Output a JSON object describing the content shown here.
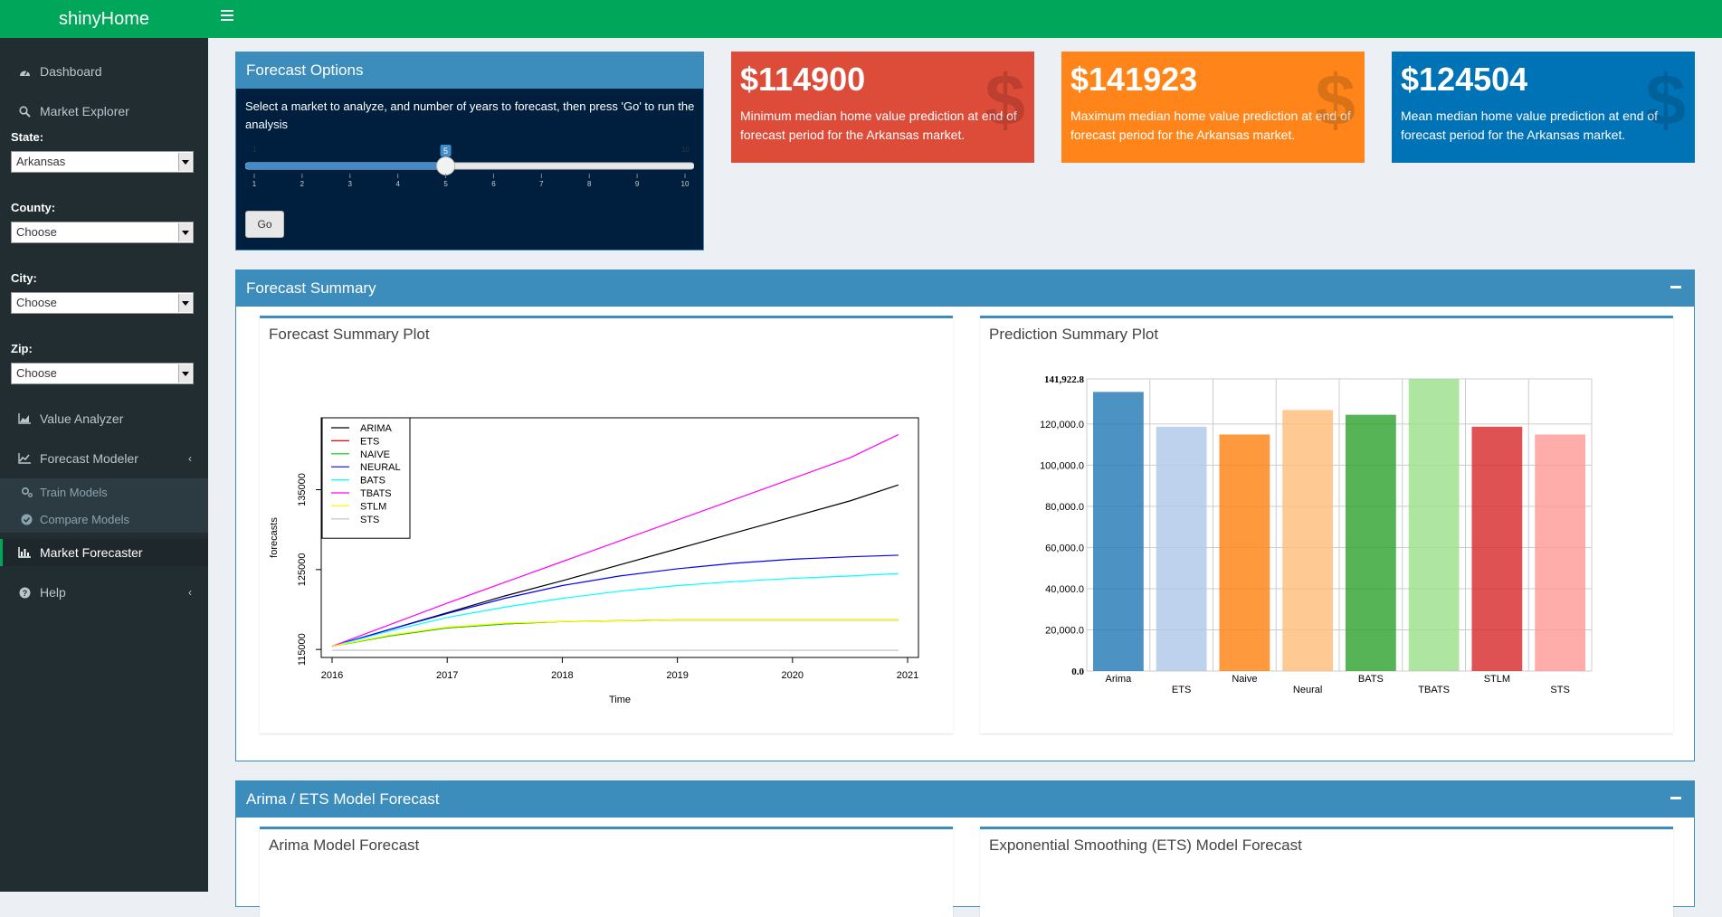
{
  "app": {
    "title": "shinyHome"
  },
  "sidebar": {
    "items": [
      {
        "label": "Dashboard",
        "icon": "dashboard-icon"
      },
      {
        "label": "Market Explorer",
        "icon": "search-icon"
      },
      {
        "label": "Value Analyzer",
        "icon": "area-chart-icon"
      },
      {
        "label": "Forecast Modeler",
        "icon": "line-chart-icon",
        "chevron": "‹"
      },
      {
        "label": "Market Forecaster",
        "icon": "bar-chart-icon",
        "active": true
      },
      {
        "label": "Help",
        "icon": "question-icon",
        "chevron": "‹"
      }
    ],
    "subitems": [
      {
        "label": "Train Models",
        "icon": "cogs-icon"
      },
      {
        "label": "Compare Models",
        "icon": "check-circle-icon"
      }
    ],
    "state": {
      "label": "State:",
      "value": "Arkansas"
    },
    "county": {
      "label": "County:",
      "value": "Choose"
    },
    "city": {
      "label": "City:",
      "value": "Choose"
    },
    "zip": {
      "label": "Zip:",
      "value": "Choose"
    }
  },
  "forecast_options": {
    "title": "Forecast Options",
    "description": "Select a market to analyze, and number of years to forecast, then press 'Go' to run the analysis",
    "slider": {
      "min": 1,
      "max": 10,
      "value": 5,
      "ticks": [
        "1",
        "2",
        "3",
        "4",
        "5",
        "6",
        "7",
        "8",
        "9",
        "10"
      ]
    },
    "go_label": "Go"
  },
  "value_boxes": [
    {
      "value": "$114900",
      "description": "Minimum median home value prediction at end of forecast period for the Arkansas market.",
      "color": "#dd4b39"
    },
    {
      "value": "$141923",
      "description": "Maximum median home value prediction at end of forecast period for the Arkansas market.",
      "color": "#ff851b"
    },
    {
      "value": "$124504",
      "description": "Mean median home value prediction at end of forecast period for the Arkansas market.",
      "color": "#0073b7"
    }
  ],
  "forecast_summary": {
    "title": "Forecast Summary",
    "line_plot_title": "Forecast Summary Plot",
    "bar_plot_title": "Prediction Summary Plot"
  },
  "arima_ets": {
    "title": "Arima / ETS Model Forecast",
    "arima_title": "Arima Model Forecast",
    "ets_title": "Exponential Smoothing (ETS) Model Forecast"
  },
  "chart_data": [
    {
      "type": "line",
      "xlabel": "Time",
      "ylabel": "forecasts",
      "xlim": [
        2016,
        2021
      ],
      "ylim": [
        114000,
        144000
      ],
      "xticks": [
        "2016",
        "2017",
        "2018",
        "2019",
        "2020",
        "2021"
      ],
      "yticks": [
        "115000",
        "125000",
        "135000"
      ],
      "x": [
        2016,
        2016.5,
        2017,
        2017.5,
        2018,
        2018.5,
        2019,
        2019.5,
        2020,
        2020.5,
        2020.92
      ],
      "series": [
        {
          "name": "ARIMA",
          "color": "#000000",
          "values": [
            115400,
            117500,
            119600,
            121700,
            123600,
            125600,
            127600,
            129600,
            131600,
            133600,
            135600
          ]
        },
        {
          "name": "ETS",
          "color": "#ff0000",
          "values": [
            115400,
            116700,
            117700,
            118200,
            118500,
            118600,
            118700,
            118700,
            118700,
            118700,
            118700
          ]
        },
        {
          "name": "NAIVE",
          "color": "#00cd00",
          "values": [
            115400,
            116700,
            117700,
            118200,
            118500,
            118600,
            118700,
            118700,
            118700,
            118700,
            118700
          ]
        },
        {
          "name": "NEURAL",
          "color": "#0000ff",
          "values": [
            115400,
            117500,
            119500,
            121400,
            123000,
            124200,
            125100,
            125800,
            126300,
            126600,
            126800
          ]
        },
        {
          "name": "BATS",
          "color": "#00ffff",
          "values": [
            115400,
            117300,
            119000,
            120300,
            121400,
            122300,
            123000,
            123500,
            123900,
            124200,
            124500
          ]
        },
        {
          "name": "TBATS",
          "color": "#ff00ff",
          "values": [
            115400,
            118100,
            120800,
            123400,
            126000,
            128600,
            131200,
            133800,
            136400,
            139000,
            141900
          ]
        },
        {
          "name": "STLM",
          "color": "#ffff00",
          "values": [
            115400,
            116800,
            117800,
            118300,
            118500,
            118600,
            118700,
            118700,
            118700,
            118700,
            118700
          ]
        },
        {
          "name": "STS",
          "color": "#bebebe",
          "values": [
            114900,
            114900,
            114900,
            114900,
            114900,
            114900,
            114900,
            114900,
            114900,
            114900,
            114900
          ]
        }
      ]
    },
    {
      "type": "bar",
      "categories": [
        "Arima",
        "ETS",
        "Naive",
        "Neural",
        "BATS",
        "TBATS",
        "STLM",
        "STS"
      ],
      "values": [
        135600,
        118700,
        114900,
        126800,
        124500,
        141922.8,
        118700,
        114900
      ],
      "colors": [
        "#1f77b4",
        "#aec7e8",
        "#ff7f0e",
        "#ffbb78",
        "#2ca02c",
        "#98df8a",
        "#d62728",
        "#ff9896"
      ],
      "ylim": [
        0,
        141922.8
      ],
      "yticks": [
        "0.0",
        "20,000.0",
        "40,000.0",
        "60,000.0",
        "80,000.0",
        "100,000.0",
        "120,000.0",
        "141,922.8"
      ]
    }
  ]
}
